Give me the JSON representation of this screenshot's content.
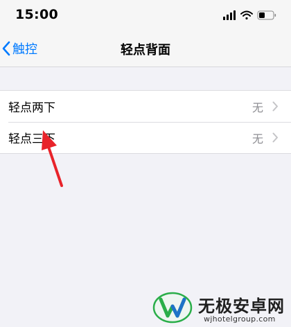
{
  "status_bar": {
    "time": "15:00",
    "icons": [
      "signal-icon",
      "wifi-icon",
      "battery-icon"
    ]
  },
  "nav": {
    "back_label": "触控",
    "back_icon": "chevron-left-icon",
    "title": "轻点背面"
  },
  "list": {
    "items": [
      {
        "label": "轻点两下",
        "value": "无",
        "icon": "chevron-right-icon"
      },
      {
        "label": "轻点三下",
        "value": "无",
        "icon": "chevron-right-icon"
      }
    ]
  },
  "annotation": {
    "icon": "red-arrow-icon",
    "color": "#e8232a"
  },
  "watermark": {
    "name": "无极安卓网",
    "url": "wjhotelgroup.com",
    "logo_colors": [
      "#2aae49",
      "#1e73c8"
    ]
  },
  "colors": {
    "accent": "#007aff",
    "background": "#f2f2f7",
    "secondary_text": "#8e8e93"
  }
}
